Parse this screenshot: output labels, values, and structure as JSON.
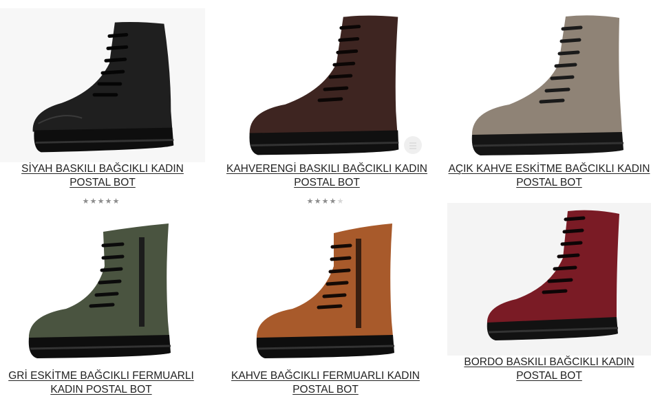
{
  "products": [
    {
      "title": "SİYAH BASKILI BAĞCIKLI KADIN POSTAL BOT",
      "rating": 5,
      "color": "#1f1f1f",
      "leather": "black"
    },
    {
      "title": "KAHVERENGİ BASKILI BAĞCIKLI KADIN POSTAL BOT",
      "rating": 4,
      "color": "#3e2521",
      "leather": "brown"
    },
    {
      "title": "AÇIK KAHVE ESKİTME BAĞCIKLI KADIN POSTAL BOT",
      "color": "#8f8376",
      "leather": "light-brown"
    },
    {
      "title": "GRİ ESKİTME BAĞCIKLI FERMUARLI KADIN POSTAL BOT",
      "color": "#4a5440",
      "leather": "grey-green",
      "zipper": true
    },
    {
      "title": "KAHVE BAĞCIKLI FERMUARLI KADIN POSTAL BOT",
      "color": "#a85a2b",
      "leather": "tan",
      "zipper": true
    },
    {
      "title": "BORDO BASKILI BAĞCIKLI KADIN POSTAL BOT",
      "color": "#7a1b25",
      "leather": "burgundy"
    }
  ],
  "icons": {
    "rating_star": "star-icon",
    "zipper": "zipper-icon"
  }
}
